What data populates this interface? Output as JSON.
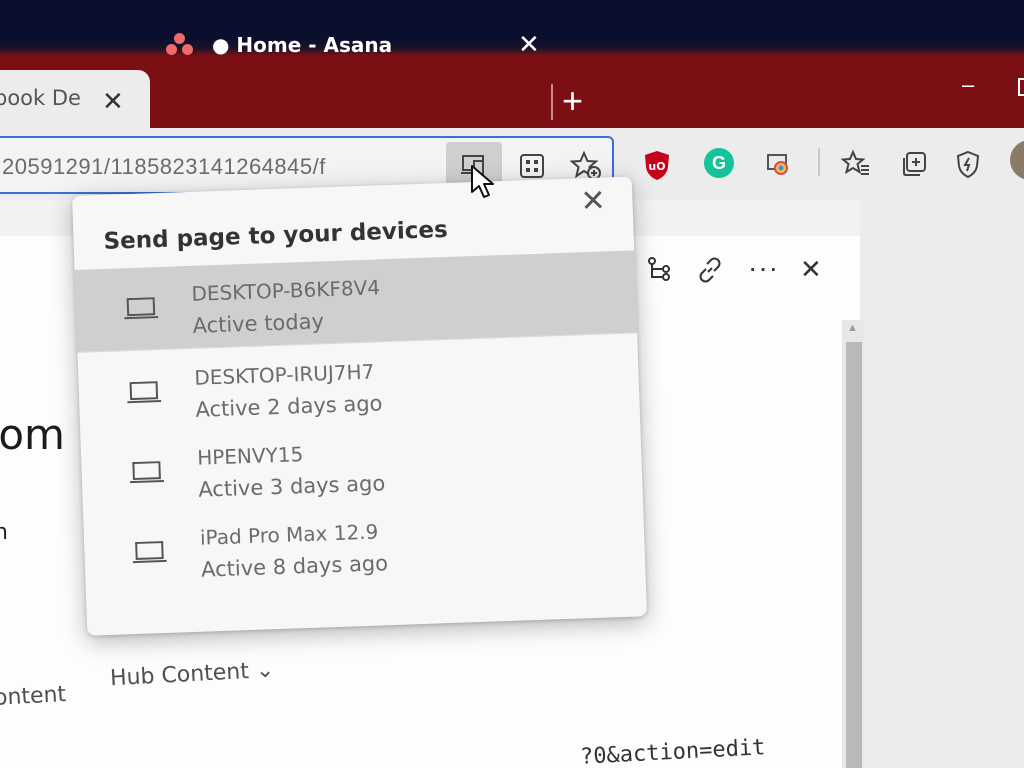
{
  "browser": {
    "tabs": [
      {
        "title": "book De",
        "close": "✕"
      },
      {
        "title": "● Home - Asana",
        "close": "✕"
      }
    ],
    "new_tab": "+",
    "minimize": "–",
    "address": "20591291/1185823141264845/f",
    "colors": {
      "tab_strip": "#7c0f13",
      "address_border": "#3b6fd8",
      "asana": "#f06a6a",
      "grammarly": "#15c39a",
      "ublock": "#c4001a"
    },
    "grammarly_letter": "G",
    "icons": [
      "send-to-devices-icon",
      "apps-icon",
      "favorite-add-icon",
      "ublock-icon",
      "grammarly-icon",
      "extension-icon",
      "favorites-icon",
      "collections-icon",
      "browser-essentials-icon"
    ]
  },
  "popup": {
    "title": "Send page to your devices",
    "close": "✕",
    "devices": [
      {
        "name": "DESKTOP-B6KF8V4",
        "status": "Active today"
      },
      {
        "name": "DESKTOP-IRUJ7H7",
        "status": "Active 2 days ago"
      },
      {
        "name": "HPENVY15",
        "status": "Active 3 days ago"
      },
      {
        "name": "iPad Pro Max 12.9",
        "status": "Active 8 days ago"
      }
    ]
  },
  "page": {
    "panel_icons": {
      "more": "···",
      "close": "✕"
    },
    "heading_fragment": "rom",
    "letter_fragment": "h",
    "content_link": "ontent",
    "hub_content": "Hub Content ⌄",
    "url_fragment": "?0&action=edit"
  }
}
